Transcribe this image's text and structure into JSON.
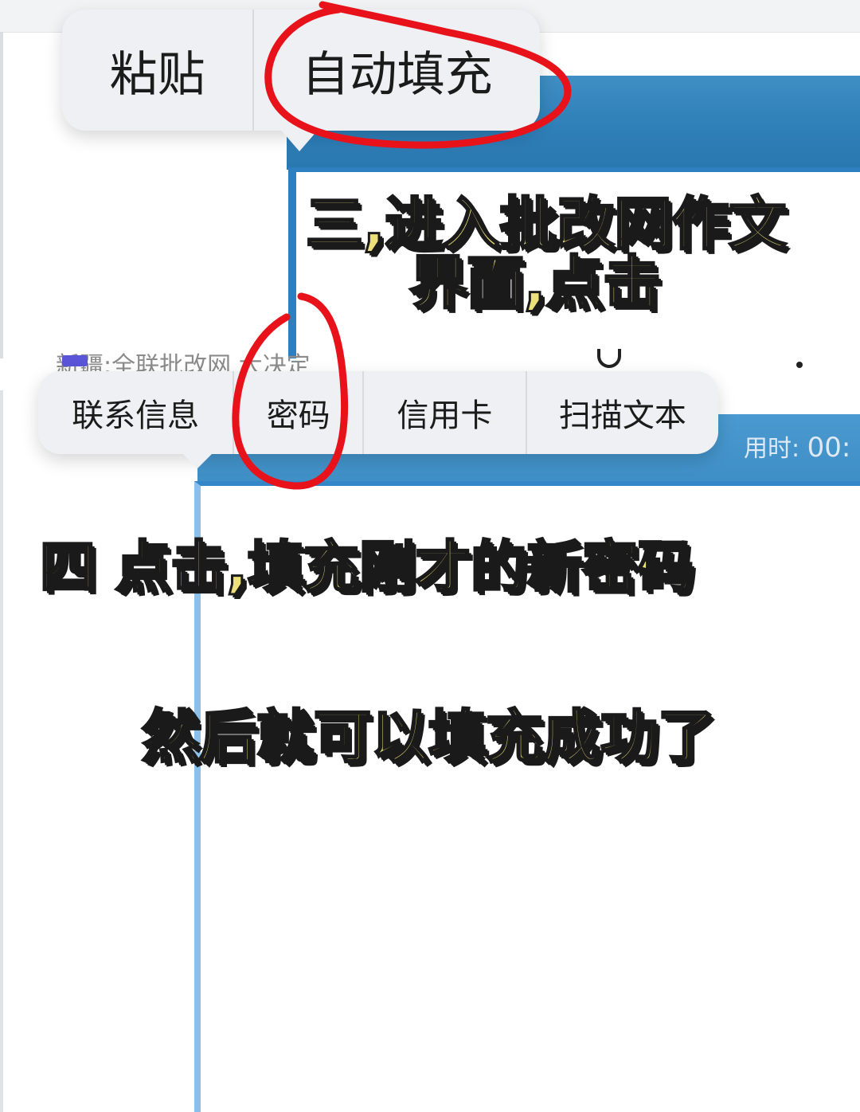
{
  "top_screen": {
    "context_menu": {
      "paste_label": "粘贴",
      "autofill_label": "自动填充"
    }
  },
  "bottom_screen": {
    "address_text": "新疆:全联批改网 大决定",
    "timer": {
      "label": "用时:",
      "value": "00:"
    },
    "context_menu": {
      "contact_label": "联系信息",
      "password_label": "密码",
      "credit_card_label": "信用卡",
      "scan_text_label": "扫描文本"
    }
  },
  "captions": {
    "step3_line1": "三,进入批改网作文",
    "step3_line2": "界面,点击",
    "step4": "四 点击,填充刚才的新密码",
    "result": "然后就可以填充成功了"
  },
  "colors": {
    "caption_fill": "#ece07a",
    "caption_outline": "#1a1a1a",
    "annotation_red": "#e8121a",
    "header_blue": "#3f8fc4",
    "menu_bg": "#eef0f3"
  }
}
